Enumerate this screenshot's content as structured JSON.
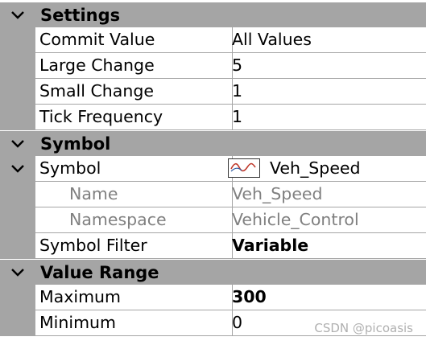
{
  "categories": {
    "settings": "Settings",
    "symbol": "Symbol",
    "value_range": "Value Range"
  },
  "settings": {
    "commit_value": {
      "name": "Commit Value",
      "value": "All Values"
    },
    "large_change": {
      "name": "Large Change",
      "value": "5"
    },
    "small_change": {
      "name": "Small Change",
      "value": "1"
    },
    "tick_frequency": {
      "name": "Tick Frequency",
      "value": "1"
    }
  },
  "symbol": {
    "symbol": {
      "name": "Symbol",
      "value": "Veh_Speed",
      "icon": "signal-wave-icon"
    },
    "name": {
      "name": "Name",
      "value": "Veh_Speed"
    },
    "namespace": {
      "name": "Namespace",
      "value": "Vehicle_Control"
    },
    "symbol_filter": {
      "name": "Symbol Filter",
      "value": "Variable"
    }
  },
  "value_range": {
    "maximum": {
      "name": "Maximum",
      "value": "300"
    },
    "minimum": {
      "name": "Minimum",
      "value": "0"
    }
  },
  "watermark": "CSDN @picoasis",
  "colors": {
    "gutter": "#a5a5a5",
    "grid_line": "#a5a5a5",
    "disabled_text": "#808080",
    "wave_red": "#c0392b"
  }
}
